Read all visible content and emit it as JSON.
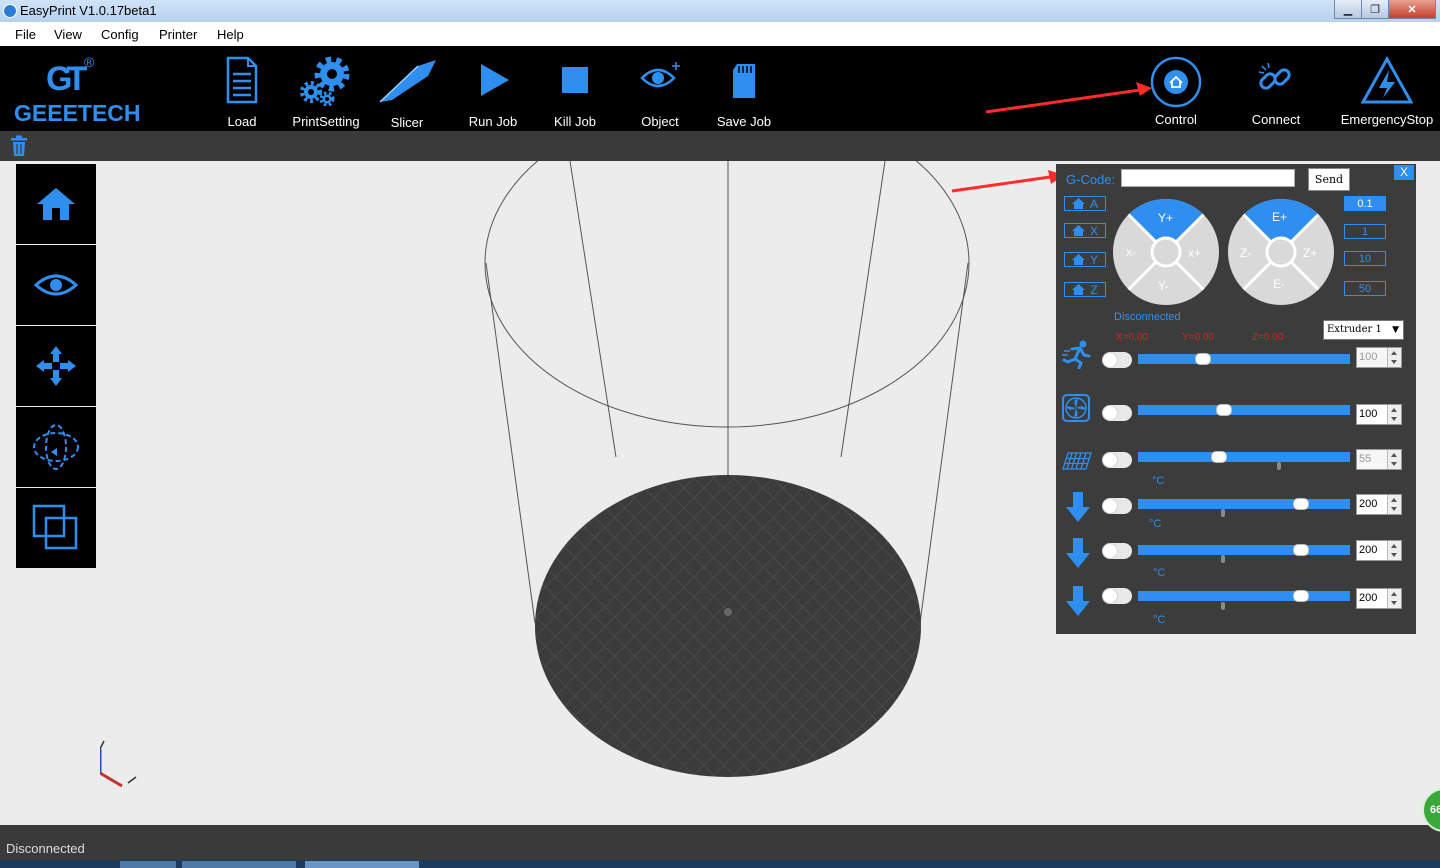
{
  "window": {
    "title": "EasyPrint  V1.0.17beta1"
  },
  "menu": [
    "File",
    "View",
    "Config",
    "Printer",
    "Help"
  ],
  "toolbar": {
    "logo": "GEEETECH",
    "logo_mark": "GT",
    "tools": [
      {
        "label": "Load",
        "icon": "load-document-icon"
      },
      {
        "label": "PrintSetting",
        "icon": "gears-icon"
      },
      {
        "label": "Slicer",
        "icon": "slicer-knife-icon"
      },
      {
        "label": "Run Job",
        "icon": "play-icon"
      },
      {
        "label": "Kill Job",
        "icon": "stop-icon"
      },
      {
        "label": "Object",
        "icon": "eye-plus-icon"
      },
      {
        "label": "Save Job",
        "icon": "sd-card-icon"
      }
    ],
    "right_tools": [
      {
        "label": "Control",
        "icon": "control-home-icon"
      },
      {
        "label": "Connect",
        "icon": "link-icon"
      },
      {
        "label": "EmergencyStop",
        "icon": "lightning-warning-icon"
      }
    ]
  },
  "sidebar": [
    "home-view-icon",
    "eye-view-icon",
    "move-arrows-icon",
    "rotate-icon",
    "scale-copy-icon"
  ],
  "control_panel": {
    "close_label": "X",
    "gcode_label": "G-Code:",
    "gcode_value": "",
    "send_label": "Send",
    "home_buttons": [
      "A",
      "X",
      "Y",
      "Z"
    ],
    "xy_pad": {
      "up": "Y+",
      "down": "Y-",
      "left": "x-",
      "right": "x+"
    },
    "ze_pad": {
      "up": "E+",
      "down": "E-",
      "left": "Z-",
      "right": "Z+"
    },
    "step_sizes": [
      "0.1",
      "1",
      "10",
      "50"
    ],
    "selected_step": "0.1",
    "connection_status": "Disconnected",
    "coords": {
      "x": "X=0.00",
      "y": "Y=0.00",
      "z": "Z=0.00"
    },
    "extruder_select": "Extruder 1",
    "rows": [
      {
        "icon": "speed-runner-icon",
        "value": "100",
        "unit": "",
        "level": 0.29,
        "enabled": false
      },
      {
        "icon": "fan-icon",
        "value": "100",
        "unit": "",
        "level": 0.4,
        "enabled": true
      },
      {
        "icon": "heated-bed-icon",
        "value": "55",
        "unit": "°C",
        "level": 0.37,
        "enabled": false
      },
      {
        "icon": "extruder-down-icon",
        "value": "200",
        "unit": "°C",
        "level": 0.79,
        "enabled": true
      },
      {
        "icon": "extruder-down-icon",
        "value": "200",
        "unit": "°C",
        "level": 0.79,
        "enabled": true
      },
      {
        "icon": "extruder-down-icon",
        "value": "200",
        "unit": "°C",
        "level": 0.79,
        "enabled": true
      }
    ],
    "colors": {
      "panel": "#3c3c3c",
      "accent": "#2f8ff0",
      "coord": "#e02020"
    }
  },
  "status": {
    "text": "Disconnected",
    "badge": "66"
  }
}
